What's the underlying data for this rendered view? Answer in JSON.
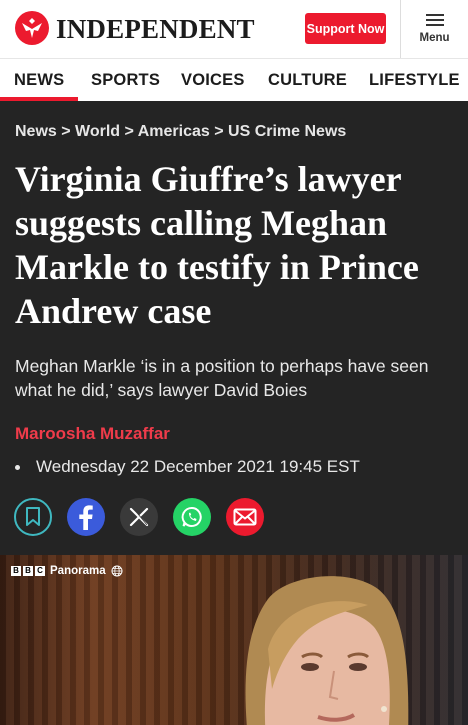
{
  "header": {
    "brand": "INDEPENDENT",
    "support_label": "Support Now",
    "menu_label": "Menu",
    "accent_color": "#ec1a2e"
  },
  "nav": {
    "items": [
      {
        "label": "NEWS",
        "active": true
      },
      {
        "label": "SPORTS"
      },
      {
        "label": "VOICES"
      },
      {
        "label": "CULTURE"
      },
      {
        "label": "LIFESTYLE"
      }
    ]
  },
  "breadcrumb": {
    "items": [
      "News",
      "World",
      "Americas",
      "US Crime News"
    ],
    "separator": ">"
  },
  "article": {
    "headline": "Virginia Giuffre’s lawyer suggests calling Meghan Markle to testify in Prince Andrew case",
    "standfirst": "Meghan Markle ‘is in a position to perhaps have seen what he did,’ says lawyer David Boies",
    "author": "Maroosha Muzaffar",
    "date": "Wednesday 22 December 2021 19:45 EST"
  },
  "share": {
    "buttons": [
      {
        "name": "bookmark",
        "icon": "bookmark-icon",
        "color": "#242424"
      },
      {
        "name": "facebook",
        "icon": "facebook-icon",
        "color": "#3b5bdb"
      },
      {
        "name": "x",
        "icon": "x-icon",
        "color": "#3a3a3a"
      },
      {
        "name": "whatsapp",
        "icon": "whatsapp-icon",
        "color": "#25d366"
      },
      {
        "name": "email",
        "icon": "email-icon",
        "color": "#ec1a2e"
      }
    ]
  },
  "media": {
    "watermark_box": [
      "B",
      "B",
      "C"
    ],
    "watermark_text": "Panorama"
  }
}
